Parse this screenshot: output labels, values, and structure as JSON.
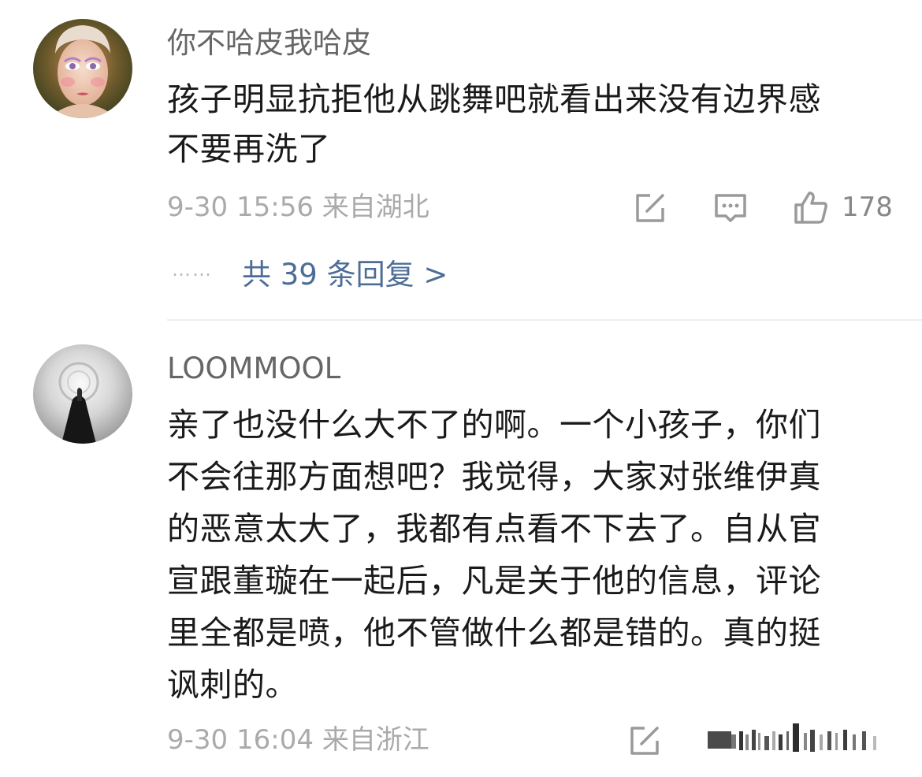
{
  "comments": [
    {
      "username": "你不哈皮我哈皮",
      "lines": [
        "孩子明显抗拒他从跳舞吧就看出来没有边界感",
        "不要再洗了"
      ],
      "meta": "9-30 15:56 来自湖北",
      "like_count": "178",
      "reply_summary": "共 39 条回复 >",
      "reply_dots": "……"
    },
    {
      "username": "LOOMMOOL",
      "lines": [
        "亲了也没什么大不了的啊。一个小孩子，你们",
        "不会往那方面想吧？我觉得，大家对张维伊真",
        "的恶意太大了，我都有点看不下去了。自从官",
        "宣跟董璇在一起后，凡是关于他的信息，评论",
        "里全都是喷，他不管做什么都是错的。真的挺",
        "讽刺的。"
      ],
      "meta": "9-30 16:04 来自浙江"
    }
  ],
  "icons": {
    "repost": "share-edit-icon",
    "comment": "comment-bubble-icon",
    "like": "thumbs-up-icon"
  },
  "colors": {
    "link": "#4e6d96",
    "meta": "#aaaaaa",
    "username": "#666666",
    "body": "#1a1a1a"
  }
}
